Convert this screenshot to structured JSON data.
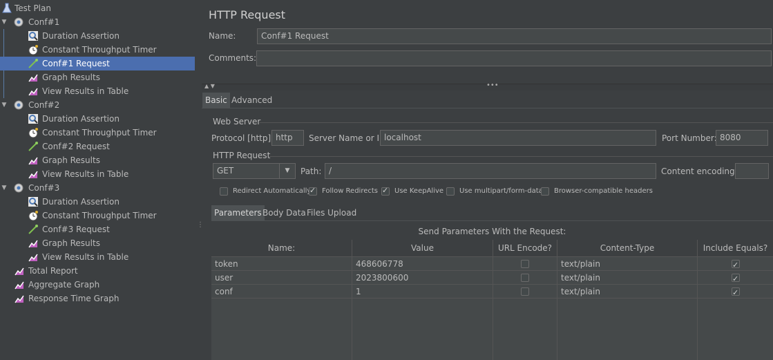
{
  "tree": {
    "items": [
      {
        "label": "Test Plan",
        "level": 0,
        "icon": "flask-icon",
        "toggle": ""
      },
      {
        "label": "Conf#1",
        "level": 0,
        "icon": "gear-icon",
        "toggle": "▼"
      },
      {
        "label": "Duration Assertion",
        "level": 1,
        "icon": "magnifier-icon",
        "toggle": ""
      },
      {
        "label": "Constant Throughput Timer",
        "level": 1,
        "icon": "stopwatch-icon",
        "toggle": ""
      },
      {
        "label": "Conf#1 Request",
        "level": 1,
        "icon": "pipette-icon",
        "toggle": "",
        "selected": true
      },
      {
        "label": "Graph Results",
        "level": 1,
        "icon": "graph-icon",
        "toggle": ""
      },
      {
        "label": "View Results in Table",
        "level": 1,
        "icon": "graph-icon",
        "toggle": ""
      },
      {
        "label": "Conf#2",
        "level": 0,
        "icon": "gear-icon",
        "toggle": "▼"
      },
      {
        "label": "Duration Assertion",
        "level": 1,
        "icon": "magnifier-icon",
        "toggle": ""
      },
      {
        "label": "Constant Throughput Timer",
        "level": 1,
        "icon": "stopwatch-icon",
        "toggle": ""
      },
      {
        "label": "Conf#2 Request",
        "level": 1,
        "icon": "pipette-icon",
        "toggle": ""
      },
      {
        "label": "Graph Results",
        "level": 1,
        "icon": "graph-icon",
        "toggle": ""
      },
      {
        "label": "View Results in Table",
        "level": 1,
        "icon": "graph-icon",
        "toggle": ""
      },
      {
        "label": "Conf#3",
        "level": 0,
        "icon": "gear-icon",
        "toggle": "▼"
      },
      {
        "label": "Duration Assertion",
        "level": 1,
        "icon": "magnifier-icon",
        "toggle": ""
      },
      {
        "label": "Constant Throughput Timer",
        "level": 1,
        "icon": "stopwatch-icon",
        "toggle": ""
      },
      {
        "label": "Conf#3 Request",
        "level": 1,
        "icon": "pipette-icon",
        "toggle": ""
      },
      {
        "label": "Graph Results",
        "level": 1,
        "icon": "graph-icon",
        "toggle": ""
      },
      {
        "label": "View Results in Table",
        "level": 1,
        "icon": "graph-icon",
        "toggle": ""
      },
      {
        "label": "Total Report",
        "level": 0,
        "icon": "graph-icon",
        "toggle": ""
      },
      {
        "label": "Aggregate Graph",
        "level": 0,
        "icon": "graph-icon",
        "toggle": ""
      },
      {
        "label": "Response Time Graph",
        "level": 0,
        "icon": "graph-icon",
        "toggle": ""
      }
    ]
  },
  "panel": {
    "title": "HTTP Request",
    "name_label": "Name:",
    "name_value": "Conf#1 Request",
    "comments_label": "Comments:",
    "comments_value": "",
    "tabs": [
      "Basic",
      "Advanced"
    ],
    "web_server": {
      "group_title": "Web Server",
      "protocol_label": "Protocol [http]:",
      "protocol_value": "http",
      "server_label": "Server Name or IP:",
      "server_value": "localhost",
      "port_label": "Port Number:",
      "port_value": "8080"
    },
    "http_request": {
      "group_title": "HTTP Request",
      "method": "GET",
      "path_label": "Path:",
      "path_value": "/",
      "encoding_label": "Content encoding:",
      "encoding_value": ""
    },
    "options": [
      {
        "label": "Redirect Automatically",
        "checked": false
      },
      {
        "label": "Follow Redirects",
        "checked": true
      },
      {
        "label": "Use KeepAlive",
        "checked": true
      },
      {
        "label": "Use multipart/form-data",
        "checked": false
      },
      {
        "label": "Browser-compatible headers",
        "checked": false
      }
    ],
    "sub_tabs": [
      "Parameters",
      "Body Data",
      "Files Upload"
    ],
    "params_caption": "Send Parameters With the Request:",
    "columns": [
      "Name:",
      "Value",
      "URL Encode?",
      "Content-Type",
      "Include Equals?"
    ],
    "rows": [
      {
        "name": "token",
        "value": "468606778",
        "url_encode": false,
        "content_type": "text/plain",
        "include_equals": true
      },
      {
        "name": "user",
        "value": "2023800600",
        "url_encode": false,
        "content_type": "text/plain",
        "include_equals": true
      },
      {
        "name": "conf",
        "value": "1",
        "url_encode": false,
        "content_type": "text/plain",
        "include_equals": true
      }
    ]
  },
  "colors": {
    "background": "#3c3f41",
    "selection": "#4b6eaf",
    "field_bg": "#45494a"
  }
}
